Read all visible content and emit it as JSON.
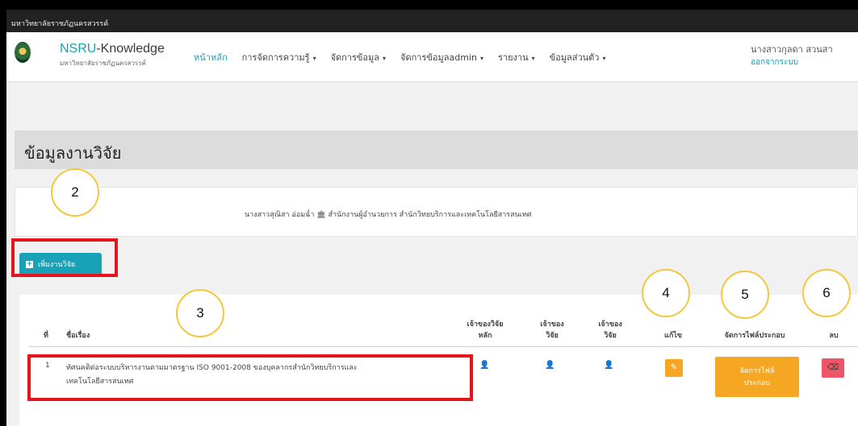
{
  "topbar": {
    "text": "มหาวิทยาลัยราชภัฏนครสวรรค์"
  },
  "navbar": {
    "brand_prefix": "NSRU",
    "brand_suffix": "-Knowledge",
    "brand_sub": "มหาวิทยาลัยราชภัฏนครสวรรค์",
    "links": [
      {
        "label": "หน้าหลัก",
        "dropdown": false
      },
      {
        "label": "การจัดการความรู้",
        "dropdown": true
      },
      {
        "label": "จัดการข้อมูล",
        "dropdown": true
      },
      {
        "label": "จัดการข้อมูลadmin",
        "dropdown": true
      },
      {
        "label": "รายงาน",
        "dropdown": true
      },
      {
        "label": "ข้อมูลส่วนตัว",
        "dropdown": true
      }
    ],
    "user_name": "นางสาวกุลดา สวนสา",
    "logout": "ออกจากระบบ"
  },
  "page": {
    "title": "ข้อมูลงานวิจัย",
    "info": "นางสาวสุณิสา อ่อมฉ่ำ 🏛 สำนักงานผู้อำนวยการ สำนักวิทยบริการและเทคโนโลยีสารสนเทศ",
    "add_button": "เพิ่มงานวิจัย"
  },
  "table": {
    "headers": {
      "no": "ที่",
      "title": "ชื่อเรื่อง",
      "owner_main": "เจ้าของวิจัย\nหลัก",
      "owner2": "เจ้าของ\nวิจัย",
      "owner3": "เจ้าของ\nวิจัย",
      "edit": "แก้ไข",
      "files": "จัดการไฟล์ประกอบ",
      "delete": "ลบ"
    },
    "rows": [
      {
        "no": "1",
        "title_line1": "ทัศนคติต่อระบบบริหารงานตามมาตรฐาน ISO 9001-2008 ของบุคลากรสำนักวิทยบริการและ",
        "title_line2": "เทคโนโลยีสารสนเทศ",
        "files_line1": "จัดการไฟล์",
        "files_line2": "ประกอบ"
      }
    ]
  },
  "callouts": [
    "2",
    "3",
    "4",
    "5",
    "6"
  ],
  "colors": {
    "accent": "#17a2b8",
    "warning": "#f5a623",
    "danger": "#ee5566",
    "highlight": "#e4151b",
    "callout_border": "#f2c83e"
  }
}
